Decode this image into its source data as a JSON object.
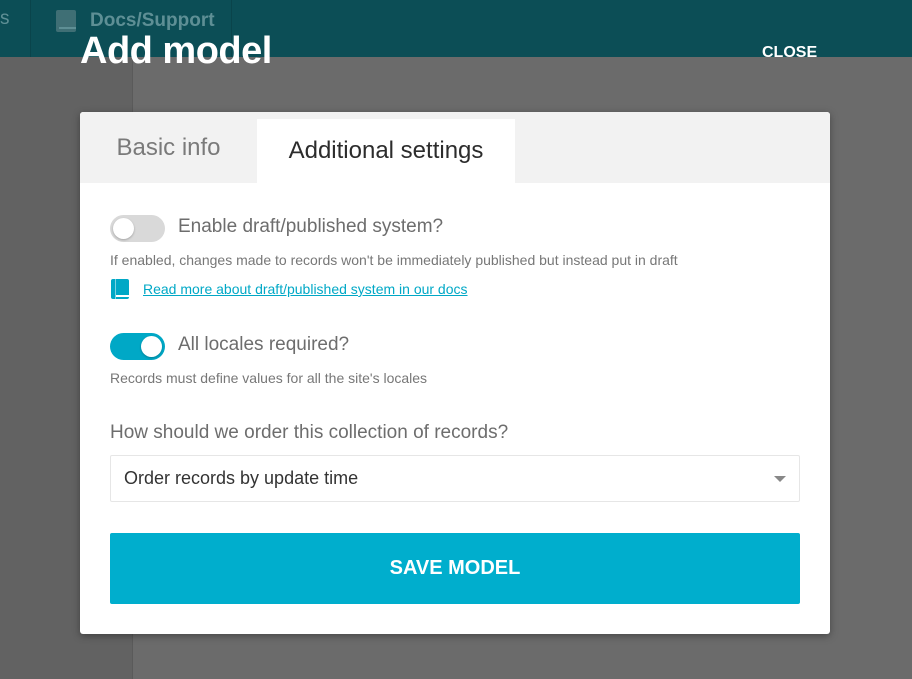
{
  "topbar": {
    "nav_fragment": "s",
    "nav_item_label": "Docs/Support",
    "nav_icon": "book-icon"
  },
  "modal": {
    "title": "Add model",
    "close_label": "CLOSE"
  },
  "tabs": [
    {
      "label": "Basic info",
      "active": false
    },
    {
      "label": "Additional settings",
      "active": true
    }
  ],
  "draft": {
    "enabled": false,
    "label": "Enable draft/published system?",
    "hint": "If enabled, changes made to records won't be immediately published but instead put in draft",
    "link_text": "Read more about draft/published system in our docs",
    "link_icon": "book-icon"
  },
  "locales": {
    "enabled": true,
    "label": "All locales required?",
    "hint": "Records must define values for all the site's locales"
  },
  "ordering": {
    "label": "How should we order this collection of records?",
    "selected": "Order records by update time"
  },
  "save_label": "SAVE MODEL",
  "colors": {
    "accent": "#00a8c6",
    "topbar": "#0c4e56",
    "overlay": "#6b6b6b"
  }
}
